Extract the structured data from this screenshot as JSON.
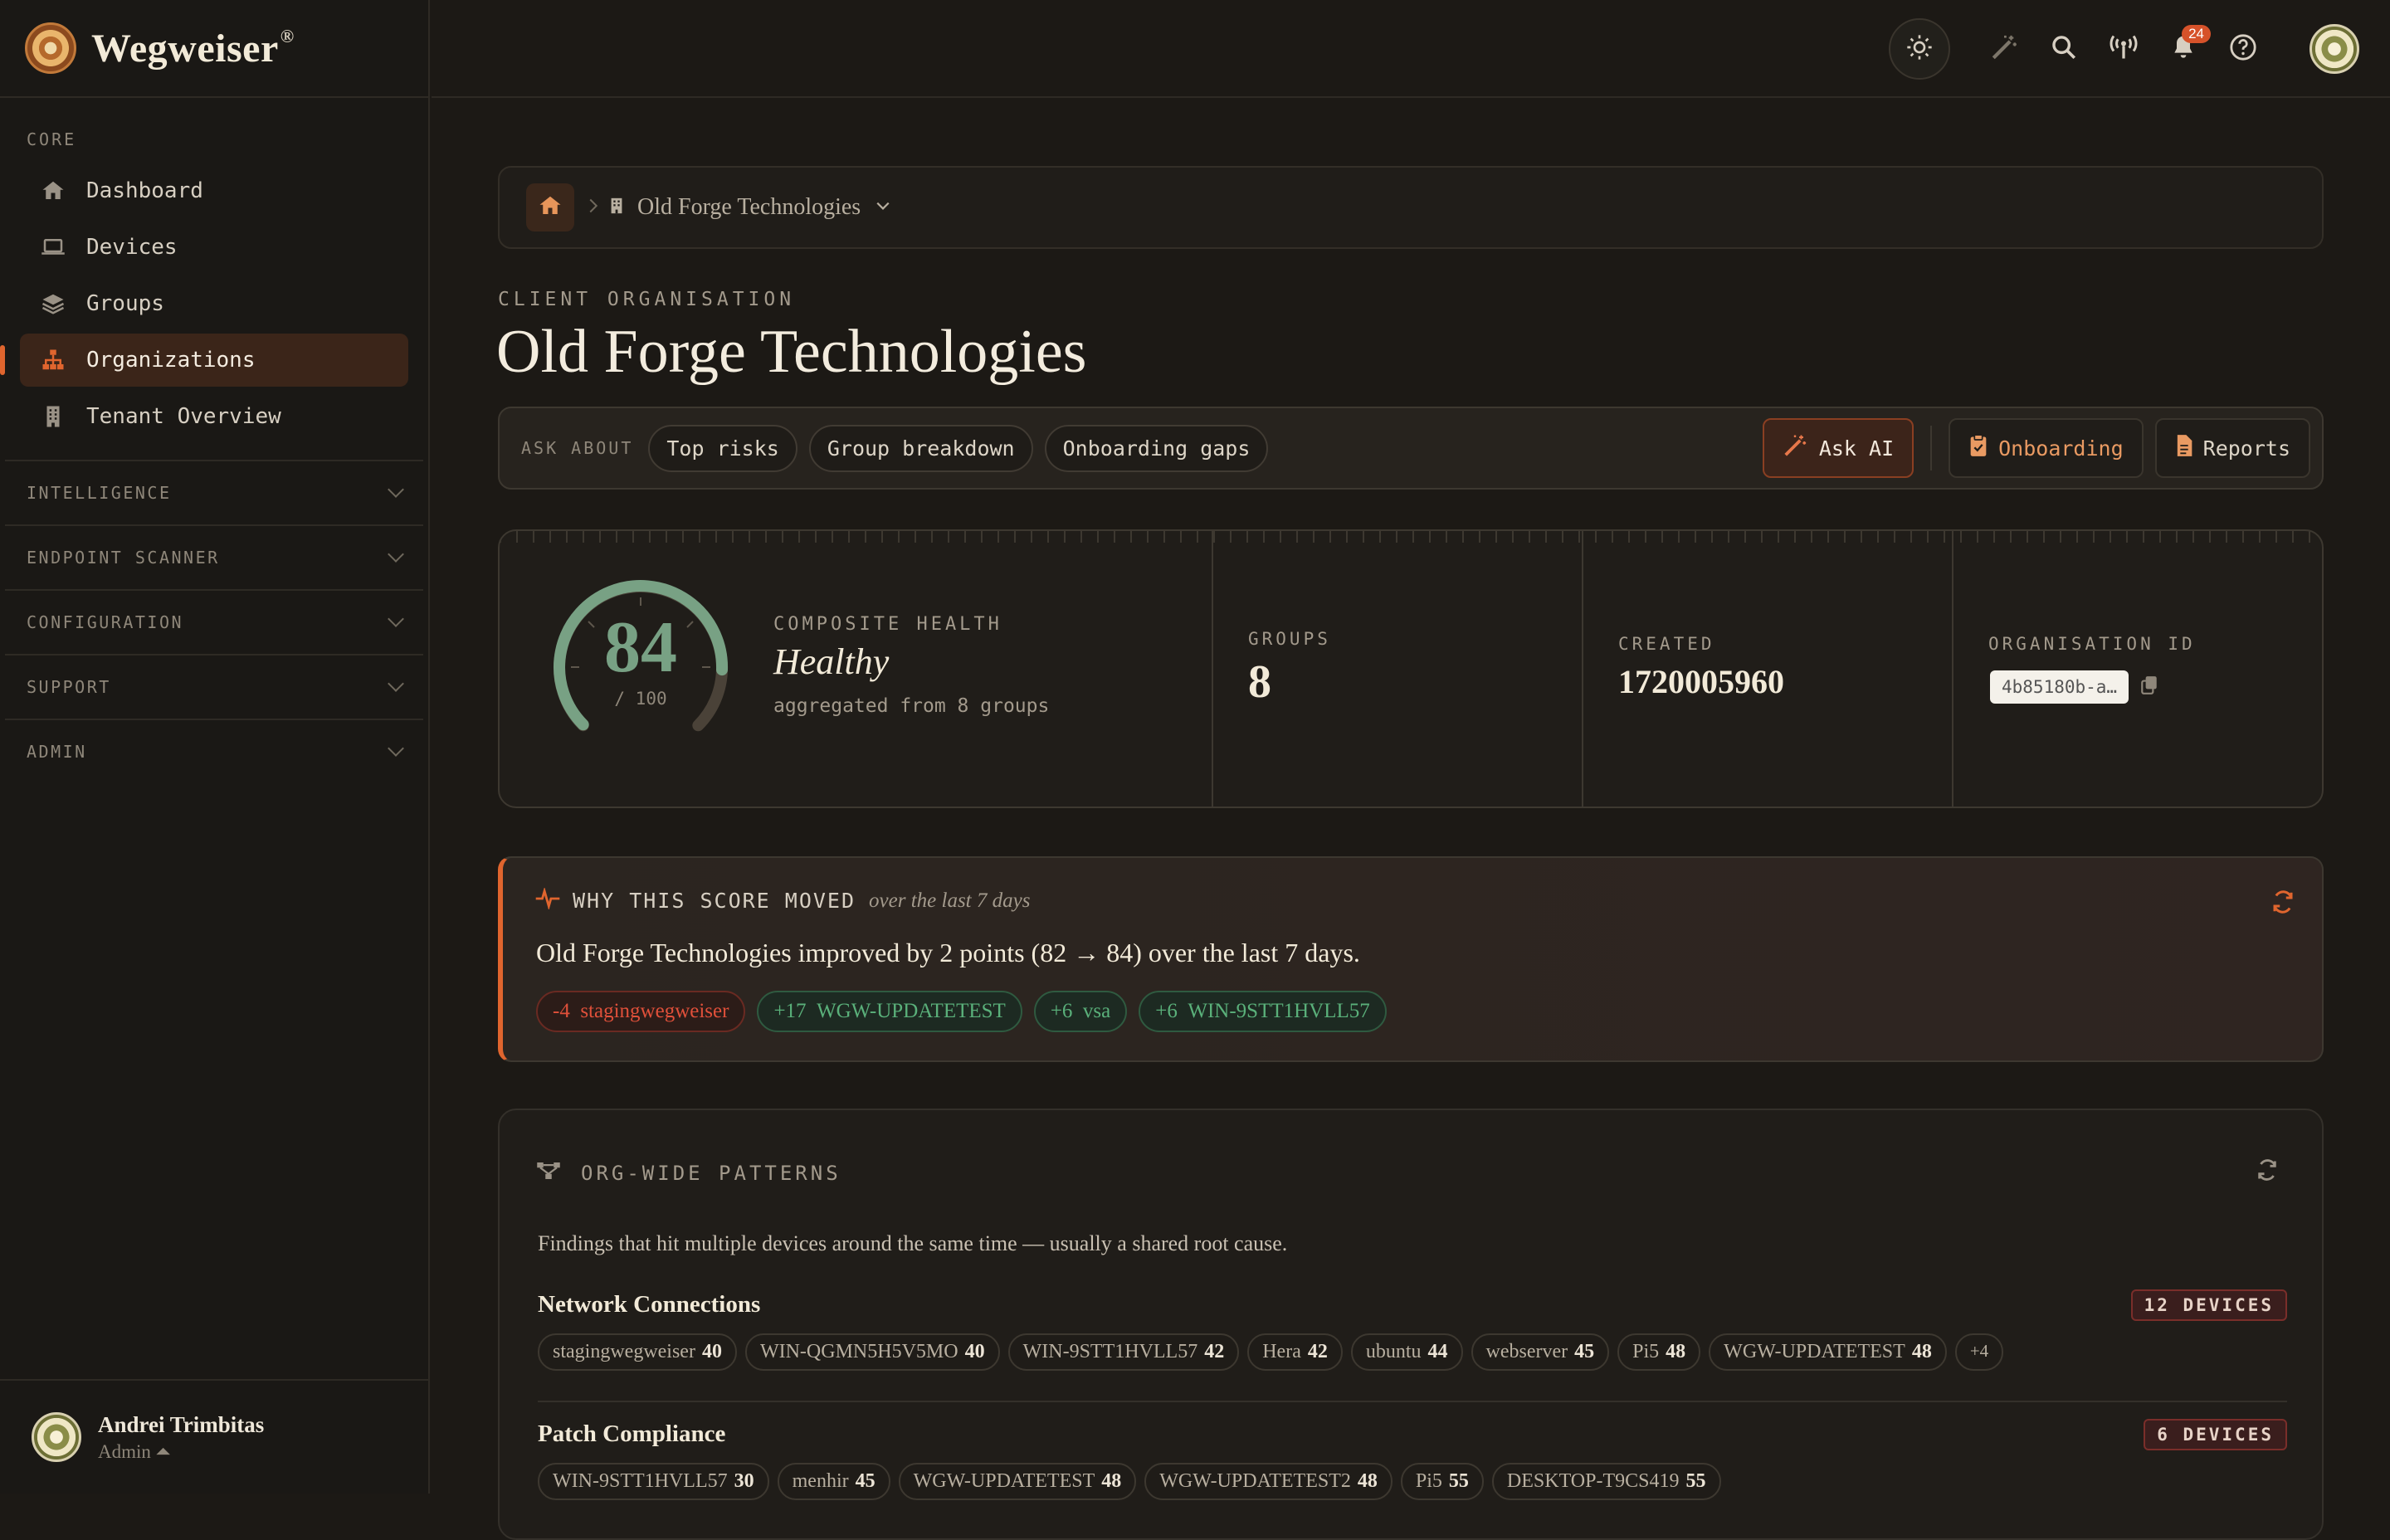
{
  "brand": {
    "name": "Wegweiser",
    "reg": "®"
  },
  "sidebar": {
    "core_label": "CORE",
    "items": [
      {
        "label": "Dashboard",
        "icon": "home-icon"
      },
      {
        "label": "Devices",
        "icon": "laptop-icon"
      },
      {
        "label": "Groups",
        "icon": "layers-icon"
      },
      {
        "label": "Organizations",
        "icon": "org-chart-icon",
        "active": true
      },
      {
        "label": "Tenant Overview",
        "icon": "building-icon"
      }
    ],
    "sections": [
      "INTELLIGENCE",
      "ENDPOINT SCANNER",
      "CONFIGURATION",
      "SUPPORT",
      "ADMIN"
    ],
    "user": {
      "name": "Andrei Trimbitas",
      "role": "Admin ⏶"
    }
  },
  "topbar": {
    "notifications_count": "24"
  },
  "breadcrumb": {
    "org": "Old Forge Technologies"
  },
  "page": {
    "eyebrow": "CLIENT ORGANISATION",
    "title": "Old Forge Technologies"
  },
  "askbar": {
    "label": "ASK ABOUT",
    "chips": [
      "Top risks",
      "Group breakdown",
      "Onboarding gaps"
    ],
    "ask_ai": "Ask AI",
    "onboarding": "Onboarding",
    "reports": "Reports"
  },
  "stats": {
    "score": "84",
    "score_max": "/ 100",
    "score_fraction": 0.84,
    "health_label": "COMPOSITE HEALTH",
    "health_value": "Healthy",
    "health_sub": "aggregated from 8 groups",
    "groups_label": "GROUPS",
    "groups_value": "8",
    "created_label": "CREATED",
    "created_value": "1720005960",
    "org_id_label": "ORGANISATION ID",
    "org_id_value": "4b85180b-a…"
  },
  "why": {
    "title": "WHY THIS SCORE MOVED",
    "subtitle": "over the last 7 days",
    "text": "Old Forge Technologies improved by 2 points (82 → 84) over the last 7 days.",
    "deltas": [
      {
        "value": "-4",
        "name": "stagingwegweiser",
        "kind": "neg"
      },
      {
        "value": "+17",
        "name": "WGW-UPDATETEST",
        "kind": "pos"
      },
      {
        "value": "+6",
        "name": "vsa",
        "kind": "pos"
      },
      {
        "value": "+6",
        "name": "WIN-9STT1HVLL57",
        "kind": "pos"
      }
    ]
  },
  "patterns": {
    "title": "ORG-WIDE PATTERNS",
    "desc": "Findings that hit multiple devices around the same time — usually a shared root cause.",
    "rows": [
      {
        "name": "Network Connections",
        "count": "12 DEVICES",
        "devices": [
          {
            "name": "stagingwegweiser",
            "score": "40"
          },
          {
            "name": "WIN-QGMN5H5V5MO",
            "score": "40"
          },
          {
            "name": "WIN-9STT1HVLL57",
            "score": "42"
          },
          {
            "name": "Hera",
            "score": "42"
          },
          {
            "name": "ubuntu",
            "score": "44"
          },
          {
            "name": "webserver",
            "score": "45"
          },
          {
            "name": "Pi5",
            "score": "48"
          },
          {
            "name": "WGW-UPDATETEST",
            "score": "48"
          },
          {
            "name": "+4",
            "score": ""
          }
        ]
      },
      {
        "name": "Patch Compliance",
        "count": "6 DEVICES",
        "devices": [
          {
            "name": "WIN-9STT1HVLL57",
            "score": "30"
          },
          {
            "name": "menhir",
            "score": "45"
          },
          {
            "name": "WGW-UPDATETEST",
            "score": "48"
          },
          {
            "name": "WGW-UPDATETEST2",
            "score": "48"
          },
          {
            "name": "Pi5",
            "score": "55"
          },
          {
            "name": "DESKTOP-T9CS419",
            "score": "55"
          }
        ]
      }
    ]
  }
}
